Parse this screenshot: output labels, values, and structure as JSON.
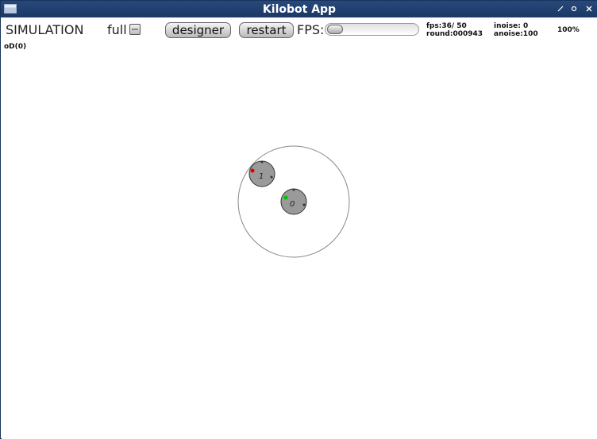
{
  "window": {
    "title": "Kilobot App",
    "controls": [
      "edit-icon",
      "dot-icon",
      "close-icon"
    ]
  },
  "toolbar": {
    "mode": "SIMULATION",
    "full_label": "full",
    "full_checked": false,
    "designer_label": "designer",
    "restart_label": "restart",
    "fps_label": "FPS:",
    "fps_slider_fraction": 0.0
  },
  "stats": {
    "fps": "fps:36/ 50",
    "round": "round:000943",
    "inoise": "inoise: 0",
    "anoise": "anoise:100",
    "zoom": "100%"
  },
  "status": {
    "text": "oD(0)"
  },
  "robots": [
    {
      "label": "1",
      "led": "#e00000"
    },
    {
      "label": "0",
      "led": "#00c000"
    }
  ],
  "colors": {
    "titlebar": "#1f3f6e",
    "robot_fill": "#9a9a9a",
    "comm_range_stroke": "#888888"
  }
}
